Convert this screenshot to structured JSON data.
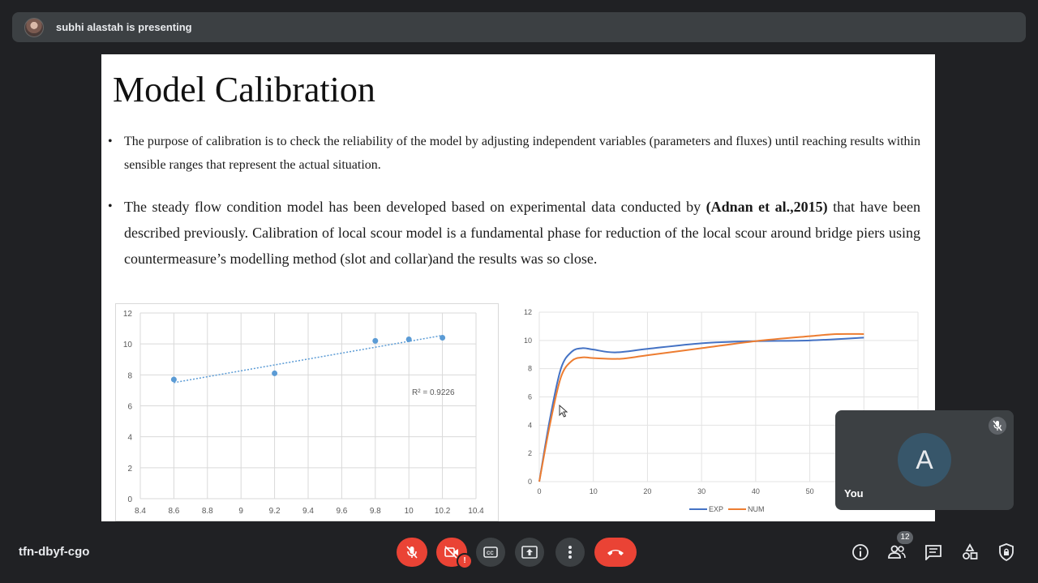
{
  "presenter": {
    "text": "subhi alastah is presenting"
  },
  "slide": {
    "title": "Model Calibration",
    "bullet1": "The purpose of calibration is to check the reliability of the model by adjusting independent variables (parameters and fluxes) until reaching results within sensible ranges that represent the actual situation.",
    "bullet2_pre": "The steady flow condition model has been developed based on experimental data conducted by ",
    "bullet2_bold": "(Adnan et al.,2015)",
    "bullet2_post": " that have been described previously. Calibration of local scour model is a fundamental phase for reduction of the local scour around bridge piers using countermeasure’s modelling method (slot and collar)and the results was so close."
  },
  "chart_data": [
    {
      "type": "scatter",
      "x": [
        8.6,
        9.2,
        9.8,
        10.0,
        10.2
      ],
      "y": [
        7.7,
        8.1,
        10.2,
        10.3,
        10.4
      ],
      "trendline": {
        "type": "linear",
        "from": [
          8.6,
          7.5
        ],
        "to": [
          10.2,
          10.55
        ]
      },
      "annotation": "R² = 0.9226",
      "xlim": [
        8.4,
        10.4
      ],
      "ylim": [
        0,
        12
      ],
      "xticks": [
        "8.4",
        "8.6",
        "8.8",
        "9",
        "9.2",
        "9.4",
        "9.6",
        "9.8",
        "10",
        "10.2",
        "10.4"
      ],
      "yticks": [
        "0",
        "2",
        "4",
        "6",
        "8",
        "10",
        "12"
      ],
      "grid": true,
      "colors": {
        "points": "#5b9bd5",
        "trend": "#5b9bd5"
      }
    },
    {
      "type": "line",
      "series": [
        {
          "name": "EXP",
          "color": "#4472c4",
          "points": [
            [
              0,
              0
            ],
            [
              2,
              4.5
            ],
            [
              4,
              8
            ],
            [
              6,
              9.2
            ],
            [
              8,
              9.45
            ],
            [
              10,
              9.35
            ],
            [
              14,
              9.15
            ],
            [
              20,
              9.4
            ],
            [
              30,
              9.8
            ],
            [
              40,
              9.95
            ],
            [
              50,
              10.0
            ],
            [
              60,
              10.2
            ]
          ]
        },
        {
          "name": "NUM",
          "color": "#ed7d31",
          "points": [
            [
              0,
              0
            ],
            [
              2,
              4.1
            ],
            [
              4,
              7.4
            ],
            [
              6,
              8.55
            ],
            [
              8,
              8.8
            ],
            [
              10,
              8.75
            ],
            [
              15,
              8.7
            ],
            [
              20,
              8.95
            ],
            [
              30,
              9.45
            ],
            [
              40,
              9.95
            ],
            [
              50,
              10.3
            ],
            [
              55,
              10.45
            ],
            [
              60,
              10.45
            ]
          ]
        }
      ],
      "xlim": [
        0,
        70
      ],
      "ylim": [
        0,
        12
      ],
      "xticks": [
        "0",
        "10",
        "20",
        "30",
        "40",
        "50"
      ],
      "yticks": [
        "0",
        "2",
        "4",
        "6",
        "8",
        "10",
        "12"
      ],
      "legend": "bottom",
      "grid": true
    }
  ],
  "self_view": {
    "initial": "A",
    "label": "You"
  },
  "meeting": {
    "code": "tfn-dbyf-cgo"
  },
  "controls": {
    "participants_count": "12",
    "camera_warning": "!"
  },
  "colors": {
    "danger": "#ea4335",
    "bg": "#202124",
    "surface": "#3c4043"
  }
}
